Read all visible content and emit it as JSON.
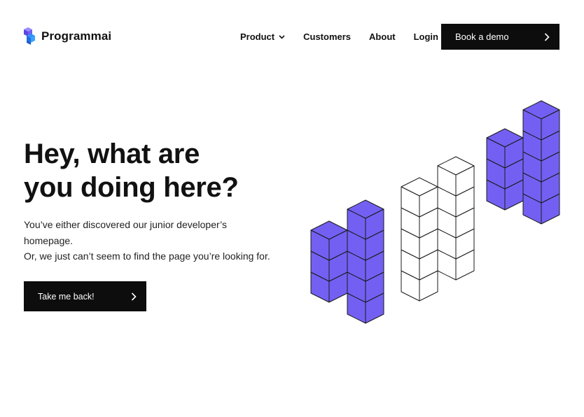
{
  "brand": {
    "name": "Programmai",
    "logo_icon": "isometric-block-logo",
    "colors": {
      "purple": "#7360f2",
      "dark": "#0d0d0d",
      "white": "#ffffff"
    }
  },
  "nav": {
    "items": [
      {
        "label": "Product",
        "has_dropdown": true,
        "icon": "chevron-down-icon"
      },
      {
        "label": "Customers"
      },
      {
        "label": "About"
      },
      {
        "label": "Login"
      }
    ],
    "cta": {
      "label": "Book a demo",
      "icon": "chevron-right-icon"
    }
  },
  "hero": {
    "title_lines": [
      "Hey, what are",
      "you doing here?"
    ],
    "body_lines": [
      "You’ve either discovered our junior developer’s",
      "homepage.",
      "Or, we just can’t seem to find the page you’re looking for."
    ],
    "button": {
      "label": "Take me back!",
      "icon": "chevron-right-icon"
    }
  },
  "illustration": {
    "description_icon": "404-isometric-cubes",
    "digits": [
      "4",
      "0",
      "4"
    ]
  }
}
